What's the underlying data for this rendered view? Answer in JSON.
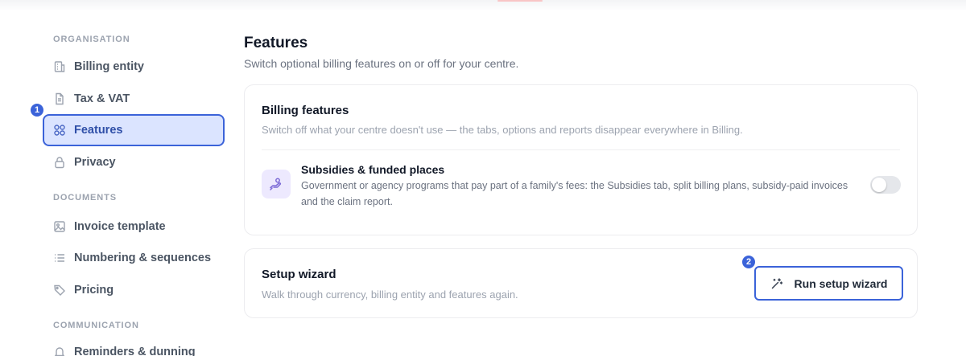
{
  "sidebar": {
    "sections": [
      {
        "label": "ORGANISATION",
        "items": [
          {
            "label": "Billing entity",
            "icon": "building-icon"
          },
          {
            "label": "Tax & VAT",
            "icon": "file-text-icon"
          },
          {
            "label": "Features",
            "icon": "grid-icon",
            "active": true
          },
          {
            "label": "Privacy",
            "icon": "lock-icon"
          }
        ]
      },
      {
        "label": "DOCUMENTS",
        "items": [
          {
            "label": "Invoice template",
            "icon": "image-icon"
          },
          {
            "label": "Numbering & sequences",
            "icon": "list-icon"
          },
          {
            "label": "Pricing",
            "icon": "tag-icon"
          }
        ]
      },
      {
        "label": "COMMUNICATION",
        "items": [
          {
            "label": "Reminders & dunning",
            "icon": "bell-icon"
          }
        ]
      }
    ]
  },
  "annotations": {
    "badge_1": "1",
    "badge_2": "2"
  },
  "main": {
    "title": "Features",
    "subtitle": "Switch optional billing features on or off for your centre.",
    "billing_card": {
      "title": "Billing features",
      "description": "Switch off what your centre doesn't use — the tabs, options and reports disappear everywhere in Billing.",
      "feature": {
        "icon": "hand-coins-icon",
        "title": "Subsidies & funded places",
        "description": "Government or agency programs that pay part of a family's fees: the Subsidies tab, split billing plans, subsidy-paid invoices and the claim report.",
        "enabled": false
      }
    },
    "wizard_card": {
      "title": "Setup wizard",
      "description": "Walk through currency, billing entity and features again.",
      "button_label": "Run setup wizard",
      "button_icon": "magic-wand-icon"
    }
  },
  "colors": {
    "accent": "#3b63d9",
    "active_bg": "#dbe4ff",
    "feature_icon_bg": "#ede9fe"
  }
}
